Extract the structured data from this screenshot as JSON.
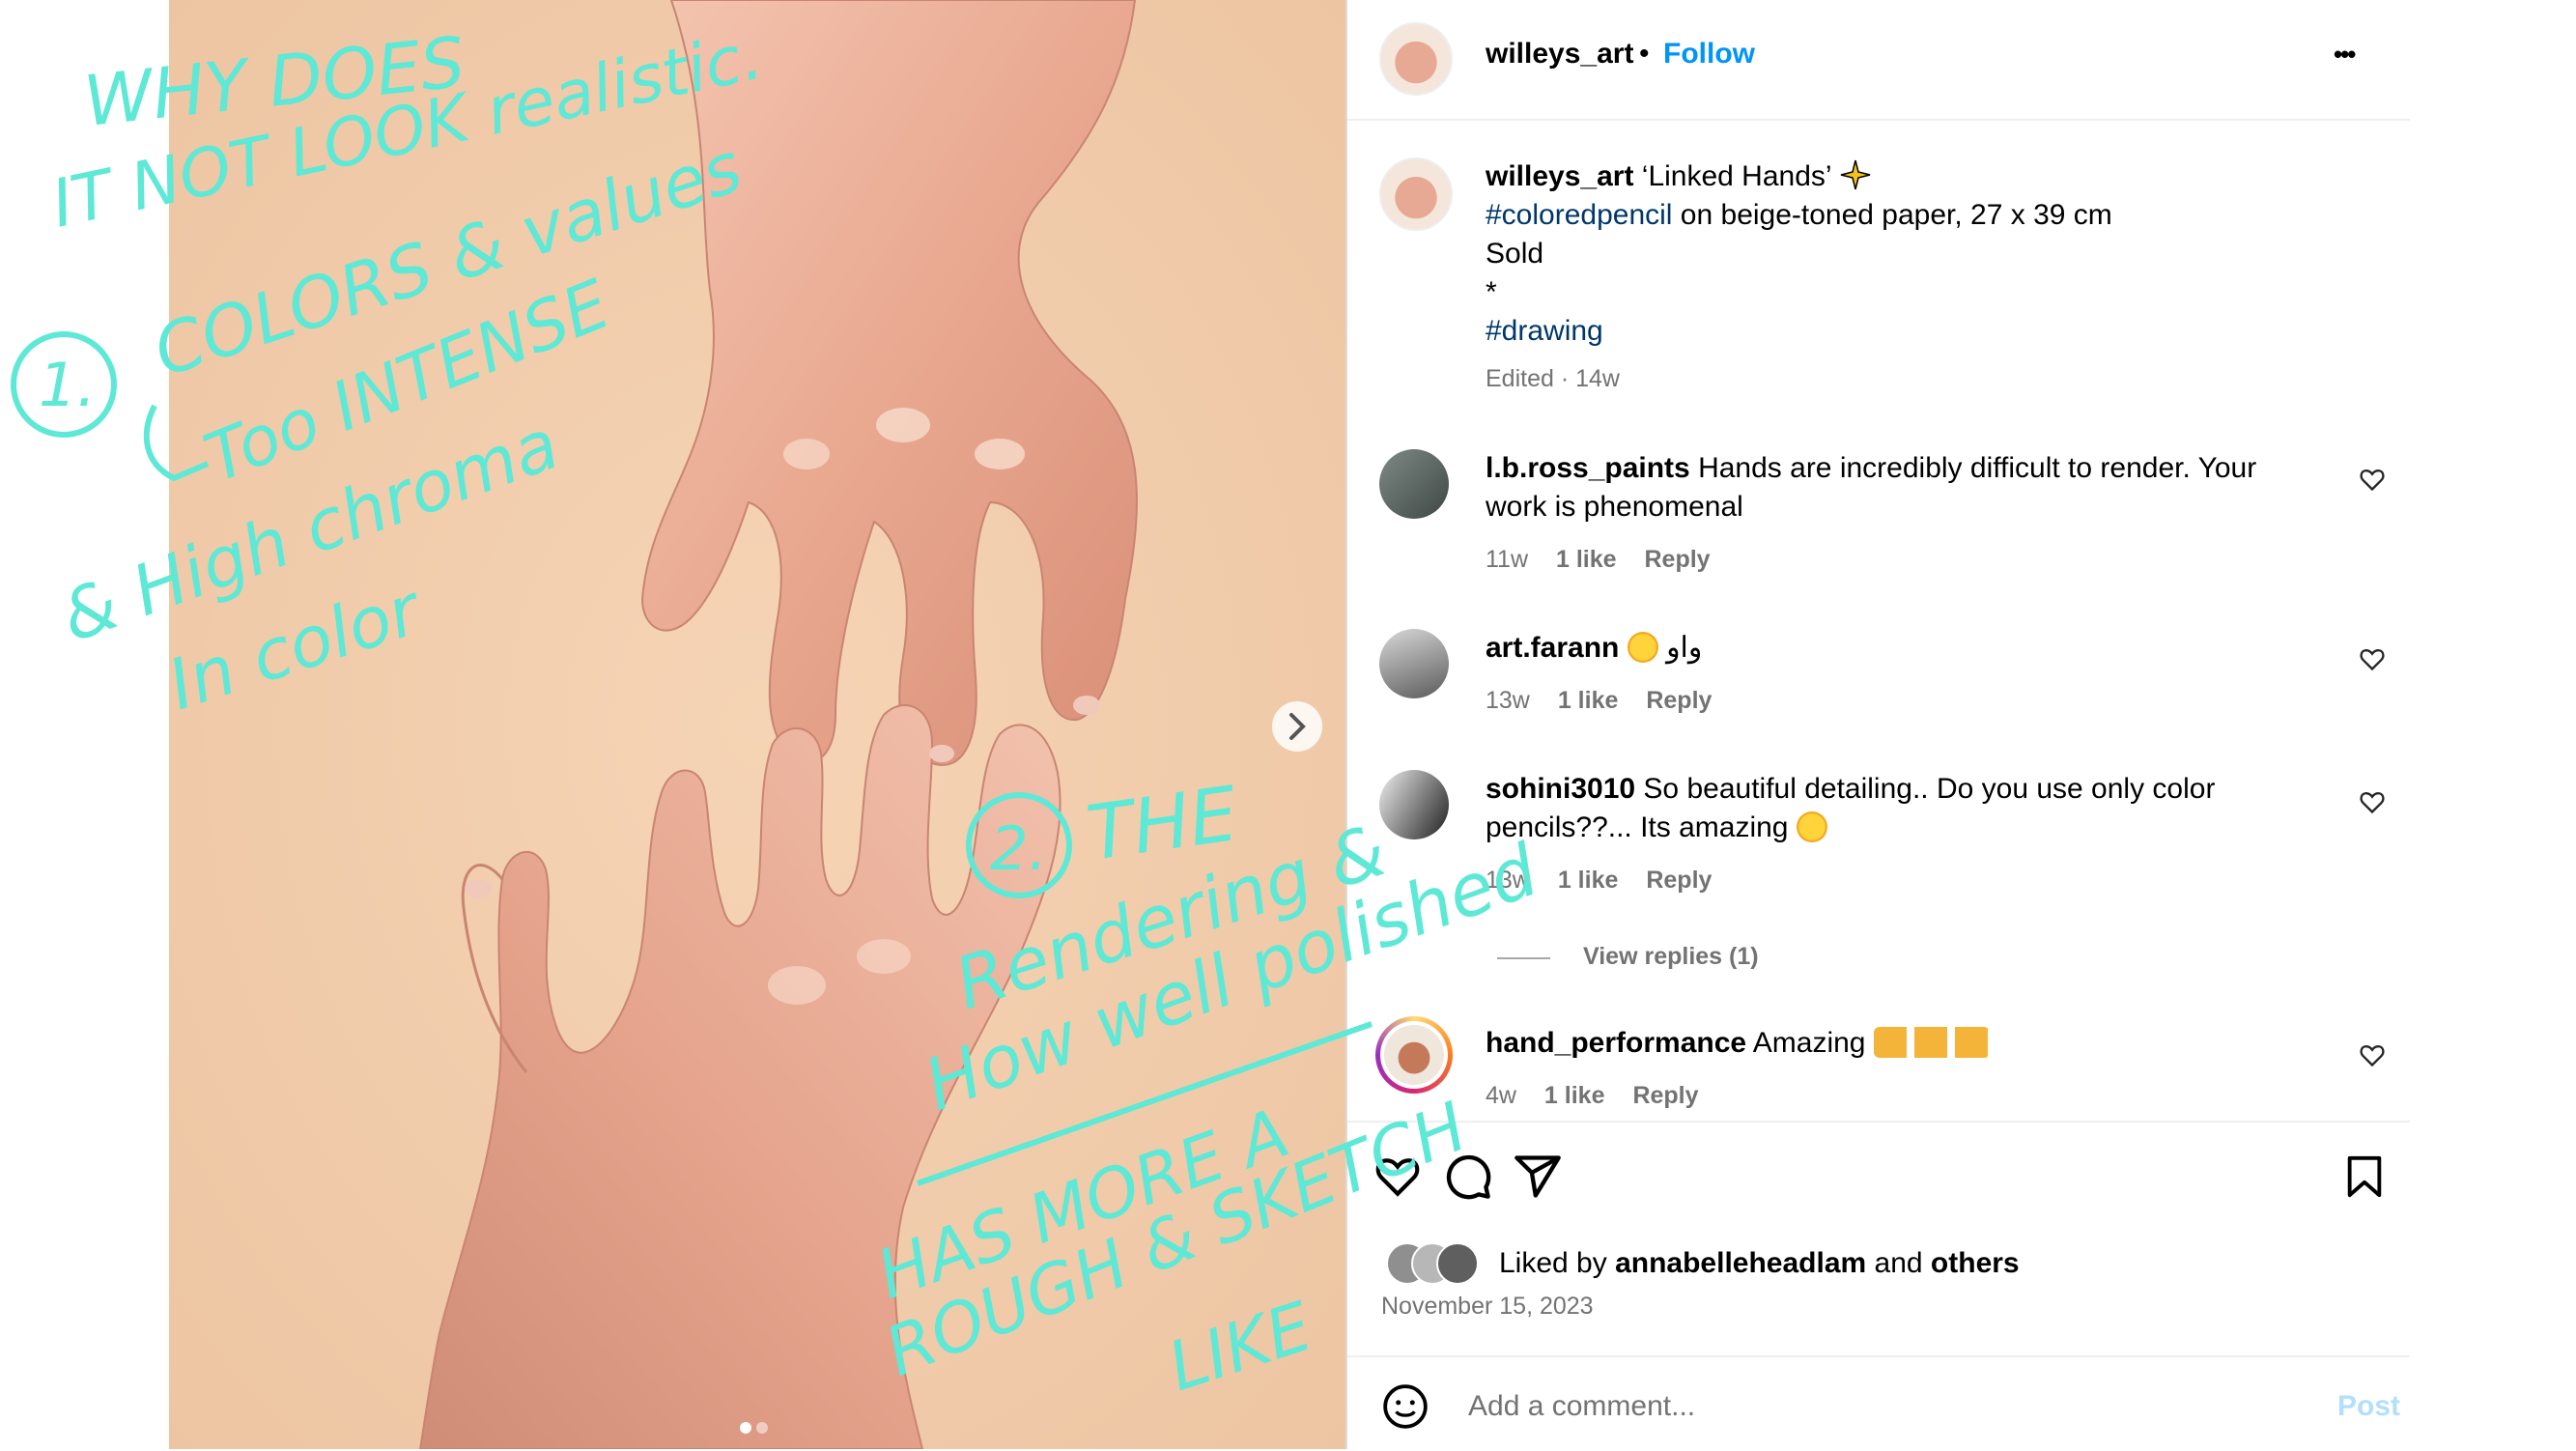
{
  "post": {
    "username": "willeys_art",
    "follow_label": "Follow",
    "dot": "•",
    "more_label": "•••"
  },
  "caption": {
    "username": "willeys_art",
    "title": "‘Linked Hands’",
    "hashtag1": "#coloredpencil",
    "line1_rest": " on beige-toned paper, 27 x 39 cm",
    "line2": "Sold",
    "line3": "*",
    "hashtag2": "#drawing",
    "edited": "Edited · 14w"
  },
  "comments": [
    {
      "username": "l.b.ross_paints",
      "text": "Hands are incredibly difficult to render. Your",
      "text2": "work is phenomenal",
      "age": "11w",
      "likes": "1 like",
      "reply": "Reply"
    },
    {
      "username": "art.farann",
      "text": "واو",
      "age": "13w",
      "likes": "1 like",
      "reply": "Reply"
    },
    {
      "username": "sohini3010",
      "text": "So beautiful detailing.. Do you use only color",
      "text2": "pencils??... Its amazing",
      "age": "13w",
      "likes": "1 like",
      "reply": "Reply"
    },
    {
      "username": "hand_performance",
      "text": "Amazing",
      "age": "4w",
      "likes": "1 like",
      "reply": "Reply"
    }
  ],
  "view_replies": "View replies (1)",
  "likes": {
    "prefix": "Liked by ",
    "user": "annabelleheadlam",
    "middle": " and ",
    "others": "others",
    "date": "November 15, 2023"
  },
  "add_comment": {
    "placeholder": "Add a comment...",
    "post_label": "Post"
  },
  "annotations": {
    "a1": "WHY DOES",
    "a2": "IT NOT LOOK realistic.",
    "a3": "1.",
    "a4": "COLORS & values",
    "a5": "Too INTENSE",
    "a6": "& High chroma",
    "a7": "In color",
    "a8": "2.",
    "a9": "THE",
    "a10": "Rendering &",
    "a11": "How well polished",
    "a12": "HAS MORE A",
    "a13": "ROUGH & SKETCH",
    "a14": "LIKE"
  },
  "colors": {
    "follow": "#0095f6",
    "annotation": "#5ee8d6",
    "paper": "#f0ccaa"
  }
}
